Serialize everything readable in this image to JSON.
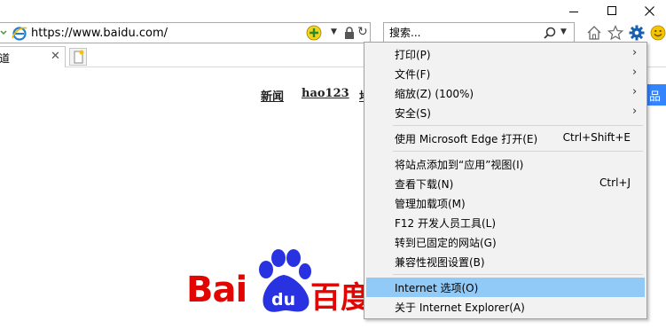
{
  "window": {
    "minimize": "minimize",
    "maximize": "maximize",
    "close": "close"
  },
  "address_bar": {
    "url": "https://www.baidu.com/"
  },
  "search": {
    "placeholder": "搜索..."
  },
  "toolbar_icons": [
    "home-icon",
    "favorites-star-icon",
    "tools-gear-icon",
    "feedback-smiley-icon"
  ],
  "tabs": [
    {
      "title": "道"
    }
  ],
  "page": {
    "nav_links": [
      "新闻",
      "hao123",
      "地"
    ],
    "login_partial": "品",
    "logo": {
      "latin": "Bai",
      "paw_text": "du",
      "chinese": "百度"
    },
    "brand_color": "#e10601",
    "paw_color": "#2932e1",
    "accent_blue": "#3385ff"
  },
  "menu": {
    "highlight_color": "#91c9f7",
    "groups": [
      [
        {
          "label": "打印(P)",
          "shortcut": "",
          "submenu": true
        },
        {
          "label": "文件(F)",
          "shortcut": "",
          "submenu": true
        },
        {
          "label": "缩放(Z) (100%)",
          "shortcut": "",
          "submenu": true
        },
        {
          "label": "安全(S)",
          "shortcut": "",
          "submenu": true
        }
      ],
      [
        {
          "label": "使用 Microsoft Edge 打开(E)",
          "shortcut": "Ctrl+Shift+E",
          "submenu": false
        }
      ],
      [
        {
          "label": "将站点添加到“应用”视图(I)",
          "shortcut": "",
          "submenu": false
        },
        {
          "label": "查看下载(N)",
          "shortcut": "Ctrl+J",
          "submenu": false
        },
        {
          "label": "管理加载项(M)",
          "shortcut": "",
          "submenu": false
        },
        {
          "label": "F12 开发人员工具(L)",
          "shortcut": "",
          "submenu": false
        },
        {
          "label": "转到已固定的网站(G)",
          "shortcut": "",
          "submenu": false
        },
        {
          "label": "兼容性视图设置(B)",
          "shortcut": "",
          "submenu": false
        }
      ],
      [
        {
          "label": "Internet 选项(O)",
          "shortcut": "",
          "submenu": false,
          "highlighted": true
        },
        {
          "label": "关于 Internet Explorer(A)",
          "shortcut": "",
          "submenu": false
        }
      ]
    ]
  }
}
